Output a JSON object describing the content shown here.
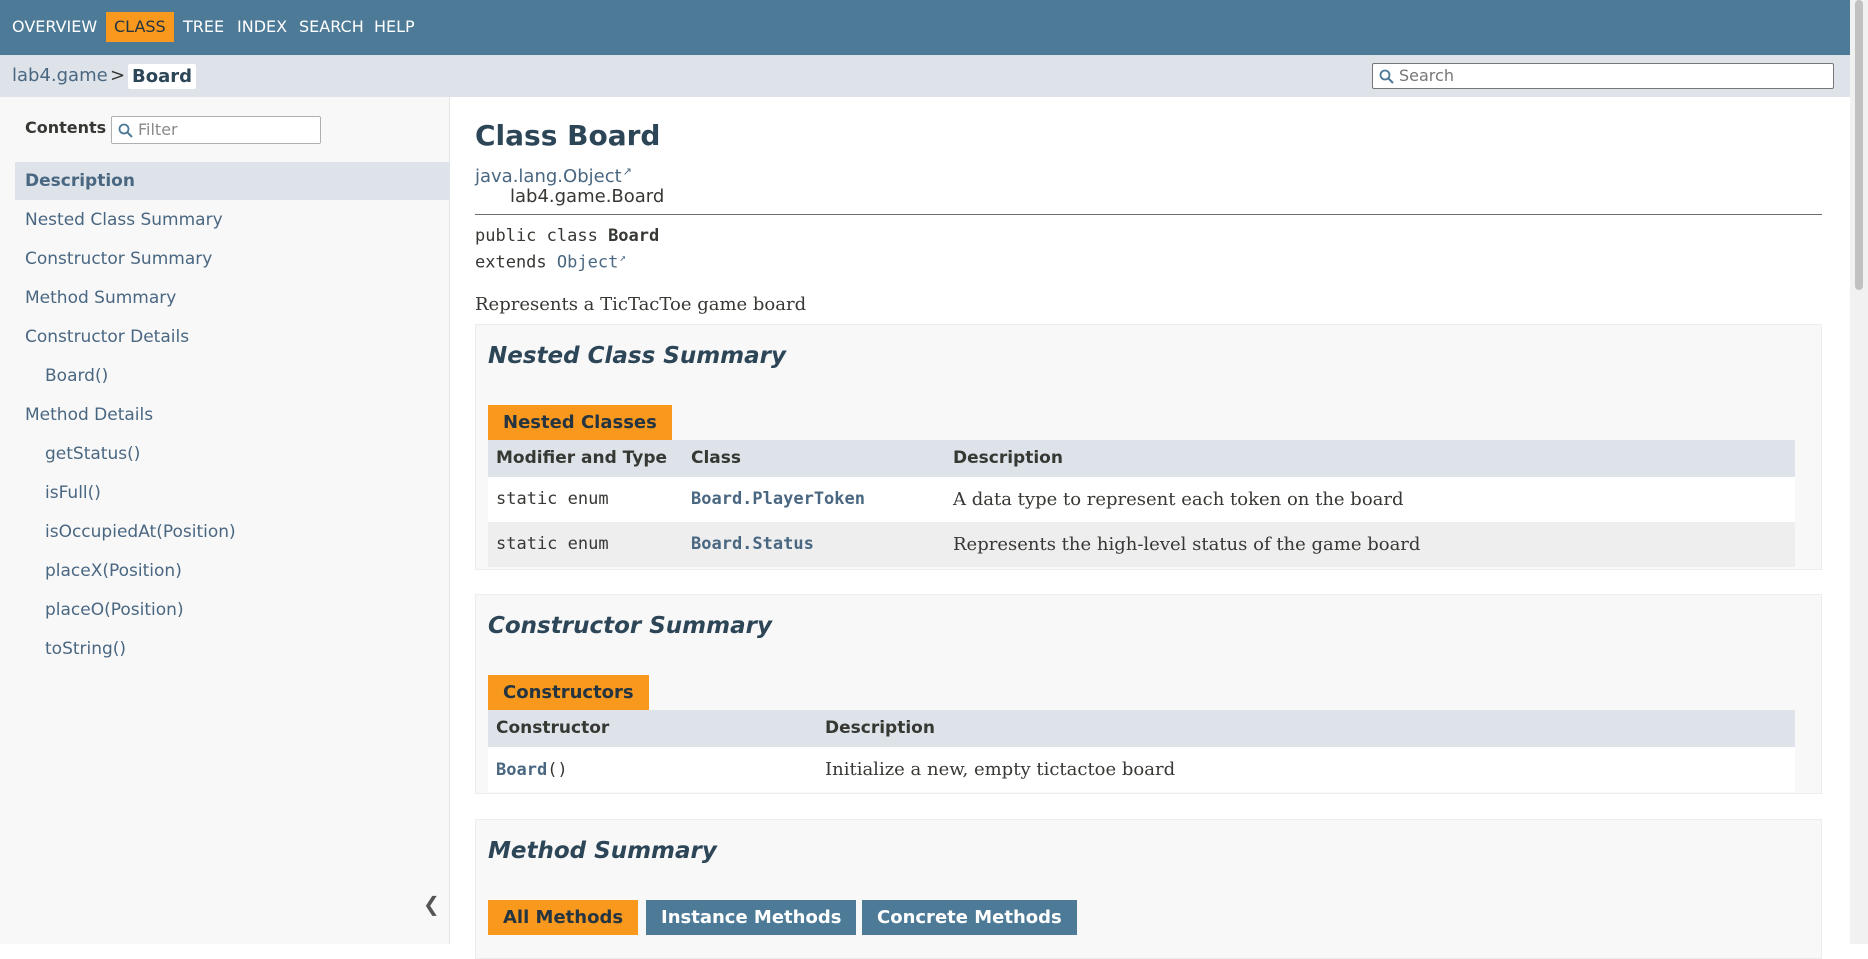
{
  "topnav": {
    "items": [
      {
        "label": "Overview",
        "active": false
      },
      {
        "label": "Class",
        "active": true
      },
      {
        "label": "Tree",
        "active": false
      },
      {
        "label": "Index",
        "active": false
      },
      {
        "label": "Search",
        "active": false
      },
      {
        "label": "Help",
        "active": false
      }
    ]
  },
  "subnav": {
    "package": "lab4.game",
    "separator": ">",
    "current": "Board",
    "search_placeholder": "Search"
  },
  "sidebar": {
    "contents_label": "Contents",
    "filter_placeholder": "Filter",
    "items": [
      {
        "label": "Description",
        "selected": true
      },
      {
        "label": "Nested Class Summary"
      },
      {
        "label": "Constructor Summary"
      },
      {
        "label": "Method Summary"
      },
      {
        "label": "Constructor Details"
      },
      {
        "label": "Board()"
      },
      {
        "label": "Method Details"
      },
      {
        "label": "getStatus()"
      },
      {
        "label": "isFull()"
      },
      {
        "label": "isOccupiedAt(Position)"
      },
      {
        "label": "placeX(Position)"
      },
      {
        "label": "placeO(Position)"
      },
      {
        "label": "toString()"
      }
    ],
    "collapse_glyph": "❮"
  },
  "main": {
    "title": "Class Board",
    "inheritance": {
      "parent": "java.lang.Object",
      "child": "lab4.game.Board"
    },
    "signature": {
      "line1_prefix": "public class ",
      "line1_name": "Board",
      "line2_prefix": "extends ",
      "line2_link": "Object"
    },
    "description": "Represents a TicTacToe game board",
    "nested": {
      "heading": "Nested Class Summary",
      "tab": "Nested Classes",
      "headers": [
        "Modifier and Type",
        "Class",
        "Description"
      ],
      "rows": [
        {
          "modifier": "static enum",
          "class": "Board.PlayerToken",
          "description": "A data type to represent each token on the board"
        },
        {
          "modifier": "static enum",
          "class": "Board.Status",
          "description": "Represents the high-level status of the game board"
        }
      ]
    },
    "constructors": {
      "heading": "Constructor Summary",
      "tab": "Constructors",
      "headers": [
        "Constructor",
        "Description"
      ],
      "rows": [
        {
          "name": "Board",
          "params": "()",
          "description": "Initialize a new, empty tictactoe board"
        }
      ]
    },
    "methods": {
      "heading": "Method Summary",
      "tabs": [
        {
          "label": "All Methods",
          "active": true
        },
        {
          "label": "Instance Methods",
          "active": false
        },
        {
          "label": "Concrete Methods",
          "active": false
        }
      ]
    }
  },
  "colors": {
    "nav_blue": "#4d7a97",
    "accent_orange": "#f8981d",
    "link": "#4a6782",
    "header_gray": "#dee3e9"
  },
  "icons": {
    "search": "magnifier-icon",
    "external": "external-link-icon",
    "collapse": "chevron-left-icon"
  }
}
